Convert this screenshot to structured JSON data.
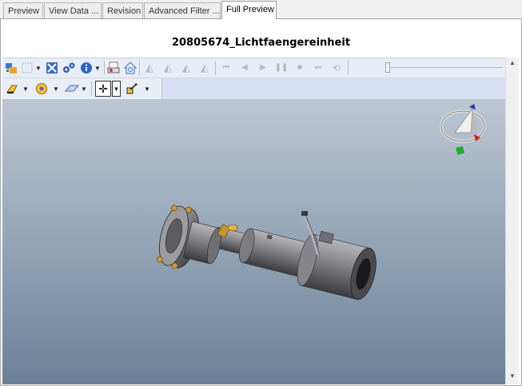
{
  "tabs": [
    "Preview",
    "View Data ...",
    "Revision",
    "Advanced Filter ...",
    "Full Preview"
  ],
  "active_tab": "Full Preview",
  "document_title": "20805674_Lichtfaengereinheit",
  "toolbar": {
    "row1": [
      "model-tree-icon",
      "fit-view-icon",
      "zoom-fit-icon",
      "settings-gear-icon",
      "info-icon",
      "print-icon",
      "home-view-icon",
      "annotation-1-icon",
      "annotation-2-icon",
      "annotation-3-icon",
      "annotation-4-icon",
      "first-frame-icon",
      "prev-frame-icon",
      "play-icon",
      "pause-icon",
      "stop-icon",
      "next-frame-icon",
      "loop-icon",
      "timeline-slider"
    ],
    "row2": [
      "shading-mode-icon",
      "view-orientation-icon",
      "section-plane-icon",
      "pan-move-icon",
      "measure-icon"
    ]
  },
  "colors": {
    "viewport_top": "#bcc7d2",
    "viewport_bottom": "#6c8197",
    "toolbar": "#e9edf5",
    "part_metal": "#8e8e92",
    "part_brass": "#c9952a",
    "triad_x": "#cc2222",
    "triad_y": "#22aa33",
    "triad_z": "#2233bb"
  }
}
